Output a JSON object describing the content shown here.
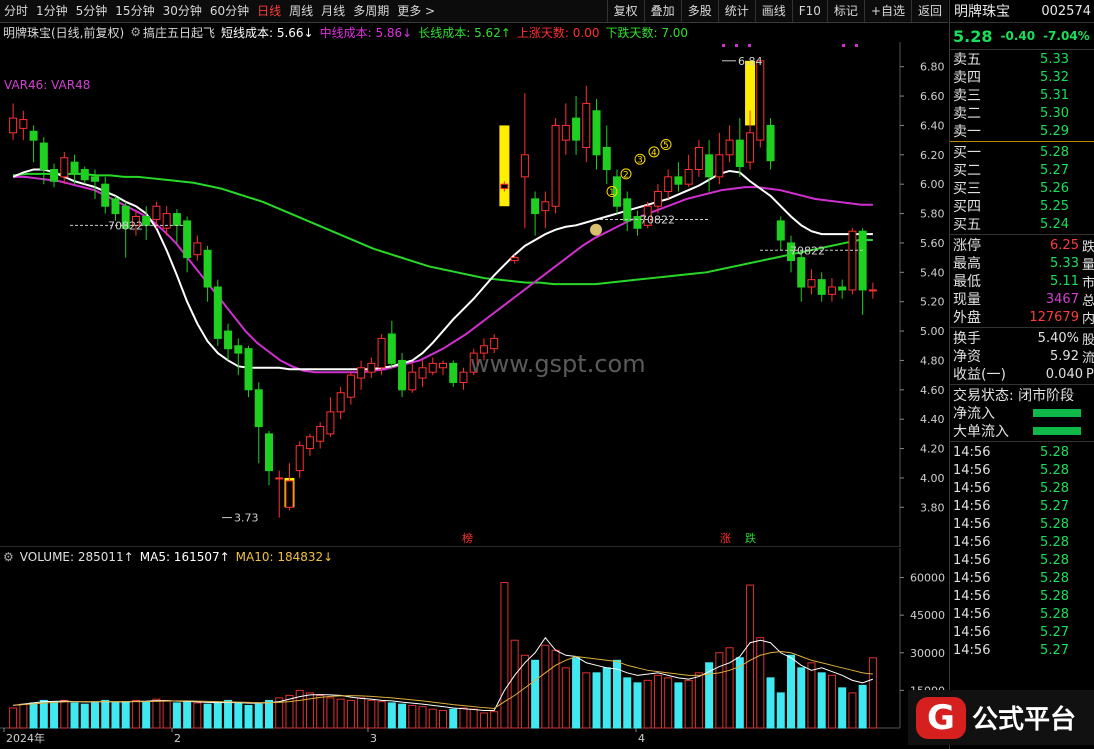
{
  "toolbar": {
    "left_items": [
      "分时",
      "1分钟",
      "5分钟",
      "15分钟",
      "30分钟",
      "60分钟",
      "日线",
      "周线",
      "月线",
      "多周期",
      "更多 >"
    ],
    "active_index": 6,
    "right_items": [
      "复权",
      "叠加",
      "多股",
      "统计",
      "画线",
      "F10",
      "标记",
      "+自选",
      "返回"
    ]
  },
  "info": {
    "stock_title": "明牌珠宝(日线,前复权)",
    "indicator_name": "搞庄五日起飞",
    "short_cost": "短线成本: 5.66↓",
    "mid_cost": "中线成本: 5.86↓",
    "long_cost": "长线成本: 5.62↑",
    "up_days": "上涨天数: 0.00",
    "down_days": "下跌天数: 7.00",
    "var_line": "VAR46: VAR48"
  },
  "chart_labels": {
    "high_mark": "6.84",
    "low_mark": "3.73",
    "line_label": "70822",
    "circle_digits": [
      "1",
      "2",
      "3",
      "4",
      "5"
    ],
    "bottom_marks": [
      "榜",
      "涨",
      "跌"
    ]
  },
  "volume_header": {
    "volume": "VOLUME: 285011↑",
    "ma5": "MA5: 161507↑",
    "ma10": "MA10: 184832↓"
  },
  "watermark": "www.gspt.com",
  "right_panel": {
    "name": "明牌珠宝",
    "code": "002574",
    "price": "5.28",
    "change": "-0.40",
    "change_pct": "-7.04%",
    "asks": [
      {
        "label": "卖五",
        "price": "5.33"
      },
      {
        "label": "卖四",
        "price": "5.32"
      },
      {
        "label": "卖三",
        "price": "5.31"
      },
      {
        "label": "卖二",
        "price": "5.30"
      },
      {
        "label": "卖一",
        "price": "5.29"
      }
    ],
    "bids": [
      {
        "label": "买一",
        "price": "5.28"
      },
      {
        "label": "买二",
        "price": "5.27"
      },
      {
        "label": "买三",
        "price": "5.26"
      },
      {
        "label": "买四",
        "price": "5.25"
      },
      {
        "label": "买五",
        "price": "5.24"
      }
    ],
    "stats1": [
      {
        "label": "涨停",
        "value": "6.25",
        "extra": "跌",
        "color": "#ff3b3b"
      },
      {
        "label": "最高",
        "value": "5.33",
        "extra": "量",
        "color": "#19e05a"
      },
      {
        "label": "最低",
        "value": "5.11",
        "extra": "市",
        "color": "#19e05a"
      },
      {
        "label": "现量",
        "value": "3467",
        "extra": "总",
        "color": "#d040d0"
      },
      {
        "label": "外盘",
        "value": "127679",
        "extra": "内",
        "color": "#ff3b3b"
      }
    ],
    "stats2": [
      {
        "label": "换手",
        "value": "5.40%",
        "extra": "股",
        "color": "#e0e0e0"
      },
      {
        "label": "净资",
        "value": "5.92",
        "extra": "流",
        "color": "#e0e0e0"
      },
      {
        "label": "收益(一)",
        "value": "0.040",
        "extra": "P",
        "color": "#e0e0e0"
      }
    ],
    "trade_status": "交易状态: 闭市阶段",
    "net_inflow": "净流入",
    "big_inflow": "大单流入",
    "ticks": [
      {
        "time": "14:56",
        "price": "5.28"
      },
      {
        "time": "14:56",
        "price": "5.28"
      },
      {
        "time": "14:56",
        "price": "5.28"
      },
      {
        "time": "14:56",
        "price": "5.27"
      },
      {
        "time": "14:56",
        "price": "5.28"
      },
      {
        "time": "14:56",
        "price": "5.28"
      },
      {
        "time": "14:56",
        "price": "5.28"
      },
      {
        "time": "14:56",
        "price": "5.28"
      },
      {
        "time": "14:56",
        "price": "5.28"
      },
      {
        "time": "14:56",
        "price": "5.28"
      },
      {
        "time": "14:56",
        "price": "5.27"
      },
      {
        "time": "14:56",
        "price": "5.27"
      }
    ]
  },
  "logo_text": "公式平台",
  "logo_letter": "G",
  "chart_data": [
    {
      "type": "candlestick",
      "title": "明牌珠宝(日线,前复权)",
      "ylim": [
        3.7,
        6.9
      ],
      "y_ticks": [
        "6.80",
        "6.60",
        "6.40",
        "6.20",
        "6.00",
        "5.80",
        "5.60",
        "5.40",
        "5.20",
        "5.00",
        "4.80",
        "4.60",
        "4.40",
        "4.20",
        "4.00",
        "3.80"
      ],
      "x_ticks": [
        "2024年",
        "2",
        "3",
        "4"
      ],
      "candles": [
        [
          6.35,
          6.45,
          6.3,
          6.55
        ],
        [
          6.38,
          6.44,
          6.3,
          6.5
        ],
        [
          6.36,
          6.3,
          6.15,
          6.4
        ],
        [
          6.28,
          6.1,
          6.0,
          6.32
        ],
        [
          6.1,
          6.02,
          5.98,
          6.14
        ],
        [
          6.05,
          6.18,
          6.0,
          6.22
        ],
        [
          6.15,
          6.08,
          6.0,
          6.2
        ],
        [
          6.1,
          6.03,
          6.0,
          6.12
        ],
        [
          6.05,
          6.02,
          5.9,
          6.1
        ],
        [
          6.0,
          5.85,
          5.8,
          6.05
        ],
        [
          5.9,
          5.8,
          5.75,
          5.92
        ],
        [
          5.85,
          5.7,
          5.5,
          5.88
        ],
        [
          5.72,
          5.78,
          5.65,
          5.82
        ],
        [
          5.78,
          5.72,
          5.62,
          5.85
        ],
        [
          5.76,
          5.85,
          5.7,
          5.88
        ],
        [
          5.7,
          5.8,
          5.65,
          5.85
        ],
        [
          5.8,
          5.72,
          5.6,
          5.83
        ],
        [
          5.75,
          5.5,
          5.4,
          5.78
        ],
        [
          5.52,
          5.6,
          5.48,
          5.65
        ],
        [
          5.55,
          5.3,
          5.2,
          5.58
        ],
        [
          5.3,
          4.95,
          4.9,
          5.35
        ],
        [
          5.0,
          4.88,
          4.8,
          5.05
        ],
        [
          4.9,
          4.85,
          4.7,
          4.95
        ],
        [
          4.88,
          4.6,
          4.55,
          4.9
        ],
        [
          4.6,
          4.35,
          4.1,
          4.65
        ],
        [
          4.3,
          4.05,
          3.95,
          4.32
        ],
        [
          4.0,
          4.0,
          3.73,
          4.05
        ],
        [
          3.8,
          3.98,
          3.78,
          4.1
        ],
        [
          4.05,
          4.22,
          4.0,
          4.25
        ],
        [
          4.2,
          4.28,
          4.15,
          4.3
        ],
        [
          4.25,
          4.35,
          4.2,
          4.38
        ],
        [
          4.3,
          4.45,
          4.28,
          4.55
        ],
        [
          4.45,
          4.58,
          4.4,
          4.62
        ],
        [
          4.55,
          4.7,
          4.5,
          4.72
        ],
        [
          4.68,
          4.75,
          4.6,
          4.8
        ],
        [
          4.72,
          4.78,
          4.68,
          4.82
        ],
        [
          4.75,
          4.95,
          4.7,
          4.98
        ],
        [
          4.98,
          4.78,
          4.75,
          5.07
        ],
        [
          4.8,
          4.6,
          4.55,
          4.85
        ],
        [
          4.6,
          4.72,
          4.58,
          4.78
        ],
        [
          4.68,
          4.75,
          4.62,
          4.8
        ],
        [
          4.72,
          4.78,
          4.7,
          4.82
        ],
        [
          4.75,
          4.78,
          4.7,
          4.8
        ],
        [
          4.78,
          4.65,
          4.62,
          4.8
        ],
        [
          4.65,
          4.72,
          4.6,
          4.75
        ],
        [
          4.72,
          4.85,
          4.7,
          4.88
        ],
        [
          4.85,
          4.9,
          4.8,
          4.95
        ],
        [
          4.88,
          4.95,
          4.85,
          4.98
        ],
        [
          5.97,
          6.0,
          5.95,
          6.02
        ],
        [
          5.48,
          5.5,
          5.46,
          5.52
        ],
        [
          6.05,
          6.2,
          5.7,
          6.62
        ],
        [
          5.9,
          5.8,
          5.65,
          5.95
        ],
        [
          5.82,
          5.88,
          5.7,
          5.95
        ],
        [
          5.85,
          6.4,
          5.8,
          6.45
        ],
        [
          6.3,
          6.4,
          6.2,
          6.55
        ],
        [
          6.45,
          6.3,
          6.2,
          6.6
        ],
        [
          6.25,
          6.55,
          6.15,
          6.67
        ],
        [
          6.5,
          6.2,
          6.1,
          6.58
        ],
        [
          6.25,
          6.1,
          6.0,
          6.4
        ],
        [
          6.05,
          5.85,
          5.8,
          6.1
        ],
        [
          5.9,
          5.75,
          5.68,
          5.95
        ],
        [
          5.78,
          5.7,
          5.65,
          5.82
        ],
        [
          5.72,
          5.85,
          5.7,
          5.88
        ],
        [
          5.85,
          5.95,
          5.8,
          6.0
        ],
        [
          5.95,
          6.05,
          5.9,
          6.1
        ],
        [
          6.05,
          6.0,
          5.95,
          6.15
        ],
        [
          6.0,
          6.1,
          5.98,
          6.2
        ],
        [
          6.1,
          6.25,
          6.05,
          6.3
        ],
        [
          6.2,
          6.05,
          5.95,
          6.3
        ],
        [
          6.05,
          6.2,
          6.0,
          6.35
        ],
        [
          6.2,
          6.3,
          6.15,
          6.4
        ],
        [
          6.3,
          6.12,
          6.05,
          6.45
        ],
        [
          6.15,
          6.35,
          6.1,
          6.5
        ],
        [
          6.3,
          6.84,
          6.25,
          6.84
        ],
        [
          6.4,
          6.16,
          6.1,
          6.45
        ],
        [
          5.75,
          5.62,
          5.55,
          5.78
        ],
        [
          5.6,
          5.48,
          5.4,
          5.65
        ],
        [
          5.5,
          5.3,
          5.2,
          5.55
        ],
        [
          5.3,
          5.35,
          5.25,
          5.42
        ],
        [
          5.35,
          5.25,
          5.2,
          5.4
        ],
        [
          5.25,
          5.3,
          5.2,
          5.36
        ],
        [
          5.3,
          5.28,
          5.22,
          5.35
        ],
        [
          5.28,
          5.68,
          5.25,
          5.7
        ],
        [
          5.68,
          5.28,
          5.11,
          5.7
        ],
        [
          5.28,
          5.28,
          5.22,
          5.33
        ]
      ],
      "yellow_bars": [
        [
          27,
          4.0,
          3.8
        ],
        [
          48,
          5.85,
          6.4
        ],
        [
          72,
          6.84,
          6.4
        ]
      ],
      "white_line": [
        6.05,
        6.08,
        6.1,
        6.1,
        6.08,
        6.05,
        6.02,
        6.0,
        5.98,
        5.95,
        5.92,
        5.88,
        5.85,
        5.8,
        5.7,
        5.55,
        5.38,
        5.2,
        5.05,
        4.93,
        4.85,
        4.8,
        4.76,
        4.75,
        4.75,
        4.75,
        4.75,
        4.74,
        4.74,
        4.74,
        4.74,
        4.74,
        4.74,
        4.74,
        4.74,
        4.74,
        4.75,
        4.76,
        4.78,
        4.8,
        4.85,
        4.92,
        5.0,
        5.08,
        5.15,
        5.22,
        5.3,
        5.38,
        5.45,
        5.52,
        5.58,
        5.62,
        5.66,
        5.69,
        5.71,
        5.72,
        5.74,
        5.76,
        5.78,
        5.8,
        5.82,
        5.84,
        5.86,
        5.88,
        5.9,
        5.93,
        5.96,
        5.99,
        6.03,
        6.07,
        6.09,
        6.08,
        6.02,
        5.97,
        5.92,
        5.85,
        5.78,
        5.72,
        5.68,
        5.66,
        5.66,
        5.66,
        5.66,
        5.66,
        5.66
      ],
      "magenta_line": [
        6.05,
        6.05,
        6.04,
        6.03,
        6.02,
        6.0,
        5.98,
        5.96,
        5.92,
        5.88,
        5.84,
        5.8,
        5.75,
        5.68,
        5.6,
        5.5,
        5.4,
        5.3,
        5.2,
        5.1,
        5.0,
        4.92,
        4.86,
        4.8,
        4.76,
        4.73,
        4.72,
        4.72,
        4.72,
        4.72,
        4.72,
        4.73,
        4.74,
        4.76,
        4.78,
        4.8,
        4.84,
        4.88,
        4.93,
        4.98,
        5.04,
        5.1,
        5.16,
        5.22,
        5.28,
        5.34,
        5.4,
        5.46,
        5.52,
        5.58,
        5.63,
        5.67,
        5.71,
        5.75,
        5.78,
        5.81,
        5.84,
        5.87,
        5.9,
        5.92,
        5.94,
        5.96,
        5.97,
        5.98,
        5.98,
        5.97,
        5.96,
        5.94,
        5.92,
        5.9,
        5.89,
        5.88,
        5.87,
        5.86,
        5.86
      ],
      "green_line": [
        6.06,
        6.07,
        6.07,
        6.07,
        6.07,
        6.07,
        6.06,
        6.06,
        6.05,
        6.05,
        6.04,
        6.03,
        6.02,
        6.01,
        5.99,
        5.97,
        5.94,
        5.91,
        5.88,
        5.84,
        5.8,
        5.76,
        5.72,
        5.68,
        5.64,
        5.6,
        5.56,
        5.53,
        5.5,
        5.47,
        5.44,
        5.42,
        5.4,
        5.38,
        5.36,
        5.35,
        5.34,
        5.33,
        5.33,
        5.32,
        5.32,
        5.32,
        5.32,
        5.33,
        5.34,
        5.35,
        5.36,
        5.37,
        5.38,
        5.39,
        5.4,
        5.42,
        5.44,
        5.46,
        5.48,
        5.5,
        5.52,
        5.54,
        5.56,
        5.58,
        5.6,
        5.62,
        5.62
      ]
    },
    {
      "type": "bar",
      "title": "VOLUME",
      "ylim": [
        0,
        63000
      ],
      "y_ticks": [
        "60000",
        "45000",
        "30000",
        "15000"
      ],
      "values": [
        8000,
        9500,
        10000,
        11000,
        10500,
        11000,
        10000,
        9500,
        10000,
        11000,
        10000,
        10500,
        11000,
        10500,
        11500,
        11000,
        10000,
        10500,
        10000,
        9500,
        10000,
        11000,
        10000,
        9000,
        9500,
        11000,
        12000,
        13000,
        15000,
        14000,
        13000,
        12000,
        11500,
        11000,
        12000,
        11000,
        10500,
        10000,
        9500,
        9000,
        8500,
        7500,
        7000,
        7500,
        8000,
        7500,
        6000,
        6500,
        58000,
        35000,
        29000,
        27000,
        33000,
        31000,
        24000,
        28000,
        22000,
        22000,
        24000,
        27000,
        20000,
        18000,
        19000,
        21000,
        20000,
        18000,
        19000,
        22000,
        26000,
        30000,
        32000,
        28000,
        57000,
        36000,
        20000,
        14000,
        29000,
        24000,
        26000,
        22000,
        21000,
        16000,
        14000,
        17000,
        28000
      ],
      "colors": "cyan for down days, hollow red for up days",
      "ma5": [
        9000,
        9500,
        10000,
        10500,
        10600,
        10700,
        10500,
        10400,
        10400,
        10500,
        10400,
        10400,
        10600,
        10700,
        10900,
        10900,
        10700,
        10600,
        10400,
        10200,
        10100,
        10200,
        10100,
        9900,
        9900,
        10100,
        10500,
        11500,
        12500,
        13200,
        13300,
        13200,
        13000,
        12300,
        11800,
        11500,
        11000,
        10800,
        10300,
        9900,
        9500,
        9000,
        8500,
        8000,
        7700,
        7400,
        7000,
        7000,
        15000,
        21000,
        26000,
        30000,
        36000,
        31000,
        29000,
        28500,
        26000,
        25000,
        24000,
        23500,
        22000,
        21000,
        21500,
        22000,
        21000,
        20000,
        19500,
        20500,
        22500,
        24500,
        26000,
        28500,
        34000,
        35000,
        34000,
        30000,
        28000,
        25000,
        23000,
        24000,
        22500,
        21000,
        19000,
        18000,
        19500
      ],
      "ma10": [
        9000,
        9300,
        9600,
        9900,
        10200,
        10400,
        10500,
        10500,
        10500,
        10500,
        10500,
        10500,
        10500,
        10500,
        10600,
        10700,
        10800,
        10800,
        10700,
        10600,
        10500,
        10400,
        10300,
        10200,
        10100,
        10100,
        10200,
        10500,
        11000,
        11600,
        12200,
        12600,
        12800,
        12900,
        12800,
        12600,
        12300,
        12000,
        11600,
        11200,
        10800,
        10300,
        9800,
        9300,
        8900,
        8500,
        8100,
        7800,
        10500,
        13000,
        16000,
        19000,
        22000,
        25000,
        27000,
        28500,
        28000,
        27500,
        27000,
        26500,
        25000,
        24000,
        23000,
        22500,
        22000,
        21500,
        21000,
        21000,
        21500,
        22000,
        23000,
        24500,
        27000,
        29000,
        30000,
        30500,
        30000,
        28500,
        27000,
        26000,
        25000,
        24000,
        23000,
        22000,
        21500
      ]
    }
  ]
}
